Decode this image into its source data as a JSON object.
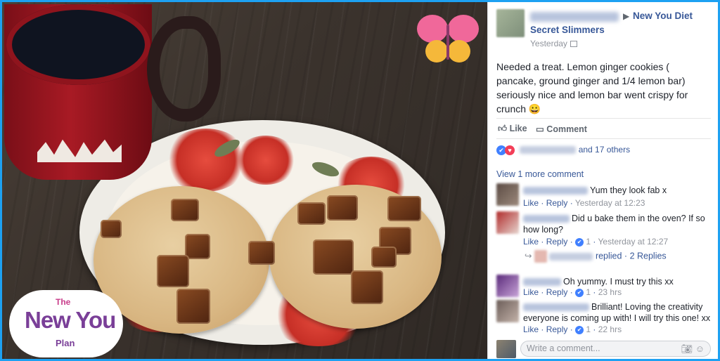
{
  "colors": {
    "frame": "#1da1f2",
    "link": "#385898",
    "meta": "#90949c",
    "like_blue": "#4080ff",
    "love_red": "#f33e58"
  },
  "logo": {
    "the": "The",
    "main": "New You",
    "plan": "Plan"
  },
  "post": {
    "group_line1": "New You Diet",
    "group_line2": "Secret Slimmers",
    "time": "Yesterday",
    "text": "Needed a treat. Lemon ginger cookies ( pancake, ground ginger and 1/4 lemon bar) seriously nice and lemon bar went crispy for crunch 😀",
    "like_label": "Like",
    "comment_label": "Comment",
    "reactions_text": "and 17 others",
    "view_more": "View 1 more comment"
  },
  "comments": [
    {
      "text": "Yum they look fab x",
      "like": "Like",
      "reply": "Reply",
      "time": "Yesterday at 12:23",
      "likes": ""
    },
    {
      "text": "Did u bake them in the oven? If so how long?",
      "like": "Like",
      "reply": "Reply",
      "time": "Yesterday at 12:27",
      "likes": "1"
    },
    {
      "text": "Oh yummy. I must try this xx",
      "like": "Like",
      "reply": "Reply",
      "time": "23 hrs",
      "likes": "1"
    },
    {
      "text": "Brilliant! Loving the creativity everyone is coming up with! I will try this one! xx",
      "like": "Like",
      "reply": "Reply",
      "time": "22 hrs",
      "likes": "1"
    }
  ],
  "replies_text": "replied · 2 Replies",
  "write": {
    "placeholder": "Write a comment..."
  },
  "icons": {
    "like": "like-icon",
    "comment": "comment-icon",
    "camera": "camera-icon",
    "emoji": "emoji-icon",
    "privacy": "group-privacy-icon",
    "reply_arrow": "reply-arrow-icon"
  }
}
